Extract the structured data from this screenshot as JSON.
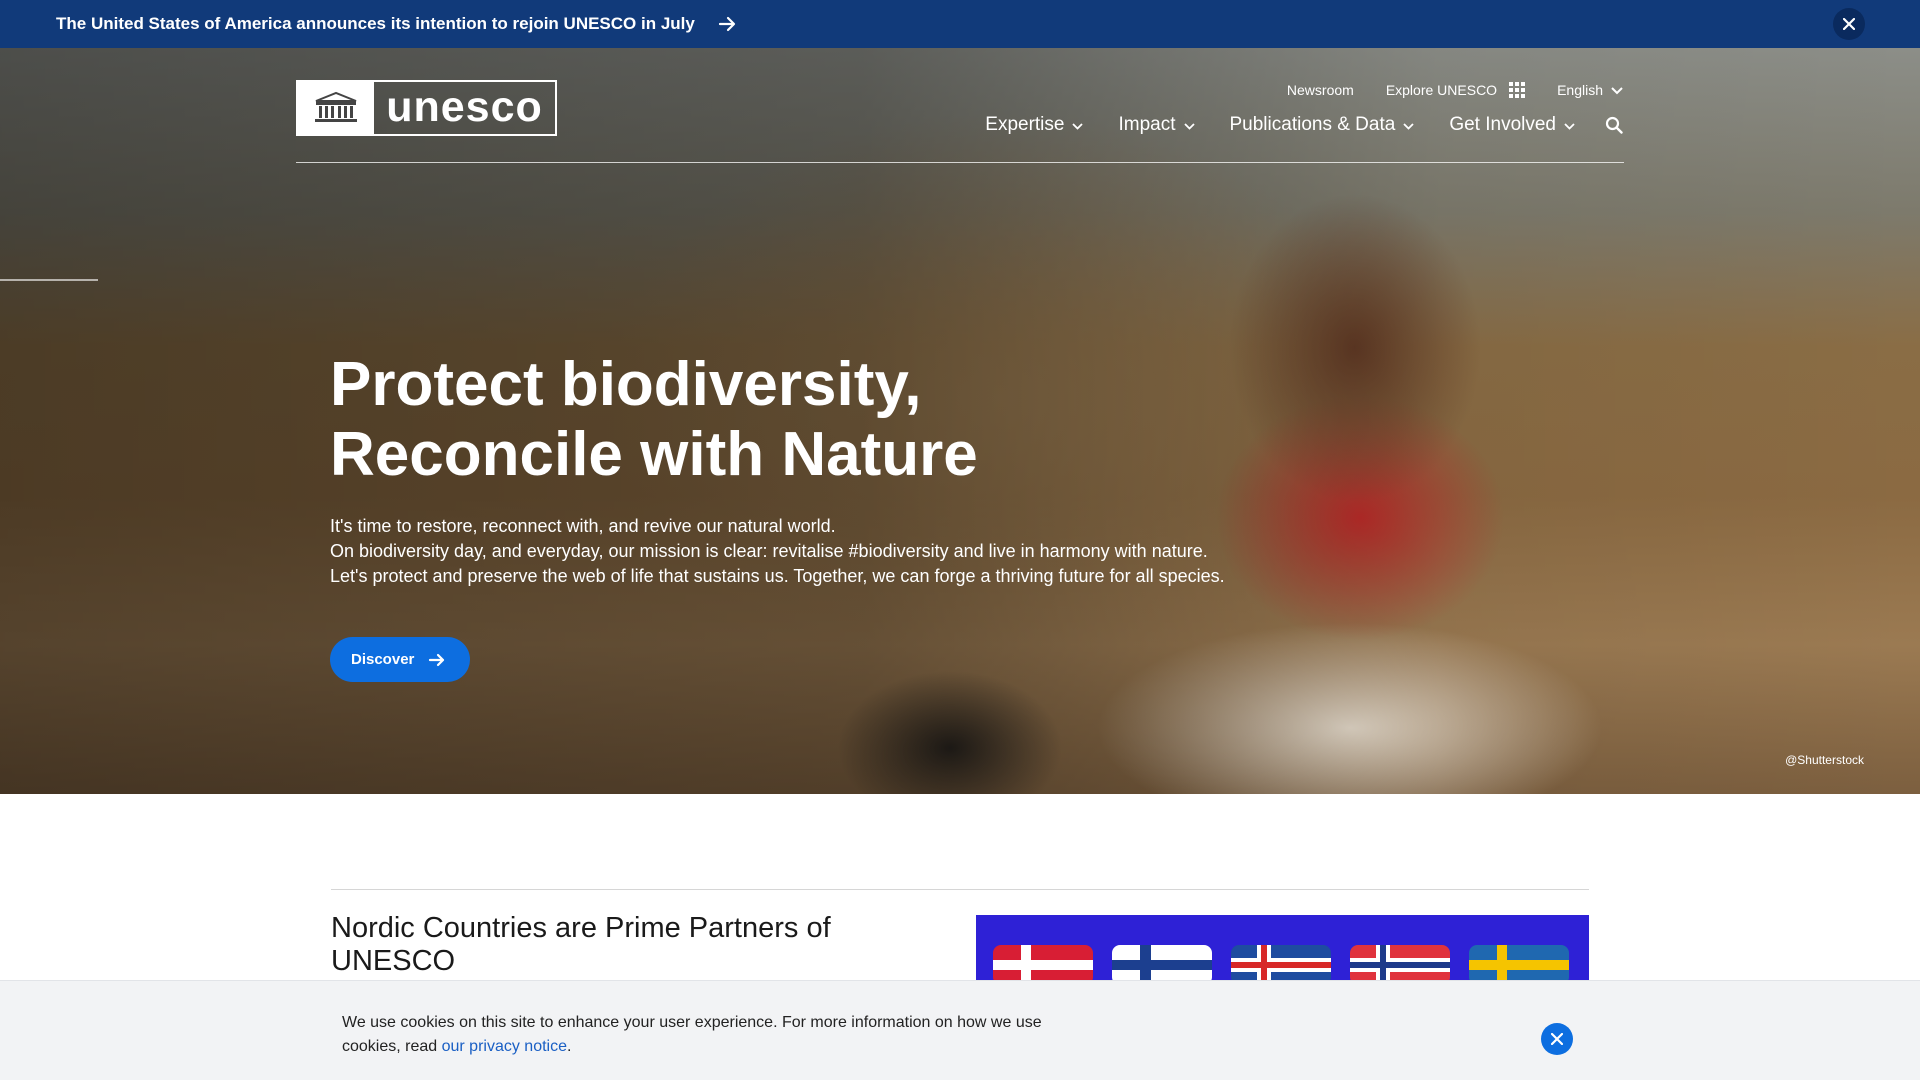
{
  "announcement": {
    "text": "The United States of America announces its intention to rejoin UNESCO in July",
    "arrow_icon": "arrow-right-icon",
    "close_icon": "close-icon"
  },
  "header": {
    "logo_text": "unesco",
    "utility_nav": {
      "newsroom": "Newsroom",
      "explore": "Explore UNESCO",
      "language": "English"
    },
    "main_nav": [
      {
        "label": "Expertise"
      },
      {
        "label": "Impact"
      },
      {
        "label": "Publications & Data"
      },
      {
        "label": "Get Involved"
      }
    ],
    "search_icon": "search-icon"
  },
  "hero": {
    "title_line1": "Protect biodiversity,",
    "title_line2": "Reconcile with Nature",
    "desc_line1": "It's time to restore, reconnect with, and revive our natural world.",
    "desc_line2": "On biodiversity day, and everyday, our mission is clear: revitalise #biodiversity and live in harmony with nature.",
    "desc_line3": "Let's protect and preserve the web of life that sustains us. Together, we can forge a thriving future for all species.",
    "cta_label": "Discover",
    "credit": "@Shutterstock"
  },
  "featured": {
    "title": "Nordic Countries are Prime Partners of UNESCO"
  },
  "cookie_banner": {
    "text_before": "We use cookies on this site to enhance your user experience. For more information on how we use cookies, read ",
    "link_text": "our privacy notice",
    "text_after": "."
  },
  "colors": {
    "announcement_bg": "#113a7a",
    "accent_blue": "#0d6ee0",
    "cookie_bg": "#f2f3f5",
    "article_image_bg": "#2e21d6"
  }
}
